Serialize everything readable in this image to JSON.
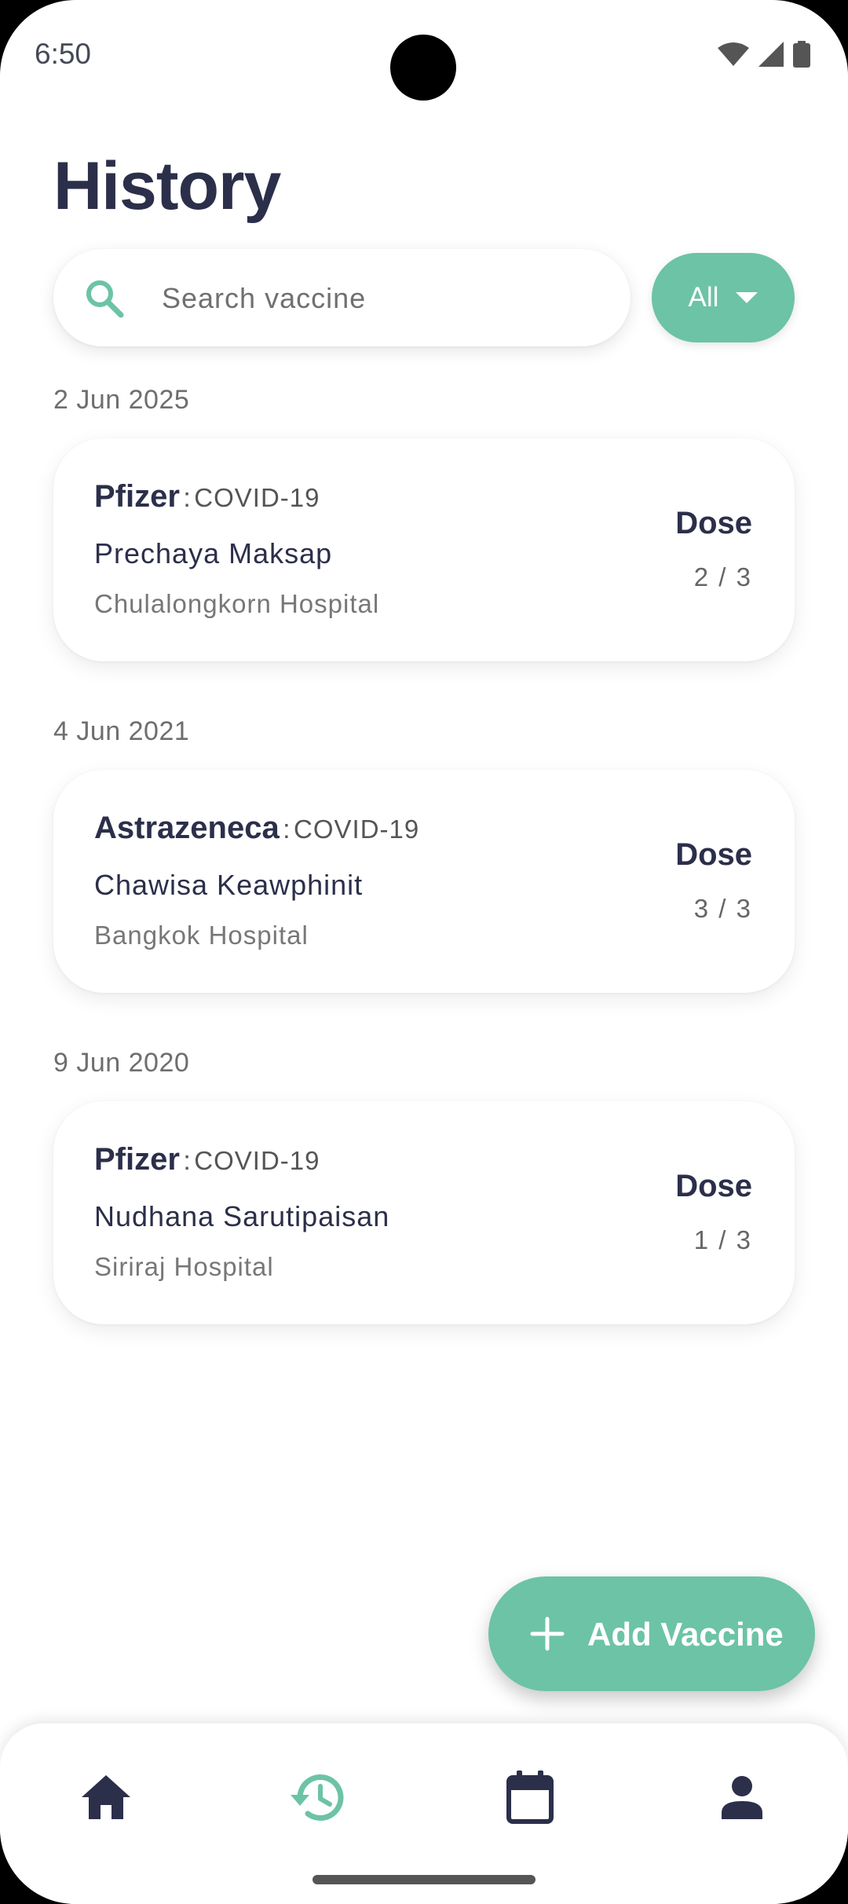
{
  "status_bar": {
    "time": "6:50"
  },
  "page": {
    "title": "History"
  },
  "search": {
    "placeholder": "Search vaccine",
    "value": ""
  },
  "filter": {
    "label": "All"
  },
  "records": [
    {
      "date": "2 Jun 2025",
      "brand": "Pfizer",
      "separator": ":",
      "vaccine_type": "COVID-19",
      "person": "Prechaya Maksap",
      "hospital": "Chulalongkorn Hospital",
      "dose_label": "Dose",
      "dose": "2 / 3"
    },
    {
      "date": "4 Jun 2021",
      "brand": "Astrazeneca",
      "separator": ":",
      "vaccine_type": "COVID-19",
      "person": "Chawisa Keawphinit",
      "hospital": "Bangkok Hospital",
      "dose_label": "Dose",
      "dose": "3 / 3"
    },
    {
      "date": "9 Jun 2020",
      "brand": "Pfizer",
      "separator": ":",
      "vaccine_type": "COVID-19",
      "person": "Nudhana Sarutipaisan",
      "hospital": "Siriraj Hospital",
      "dose_label": "Dose",
      "dose": "1 / 3"
    }
  ],
  "fab": {
    "label": "Add Vaccine",
    "icon": "plus-icon"
  },
  "bottom_nav": {
    "items": [
      {
        "name": "home",
        "icon": "home-icon",
        "active": false
      },
      {
        "name": "history",
        "icon": "history-icon",
        "active": true
      },
      {
        "name": "calendar",
        "icon": "calendar-icon",
        "active": false
      },
      {
        "name": "profile",
        "icon": "person-icon",
        "active": false
      }
    ]
  },
  "colors": {
    "accent": "#6cc3a6",
    "navy": "#2c2f4a",
    "background": "#ffffff"
  }
}
